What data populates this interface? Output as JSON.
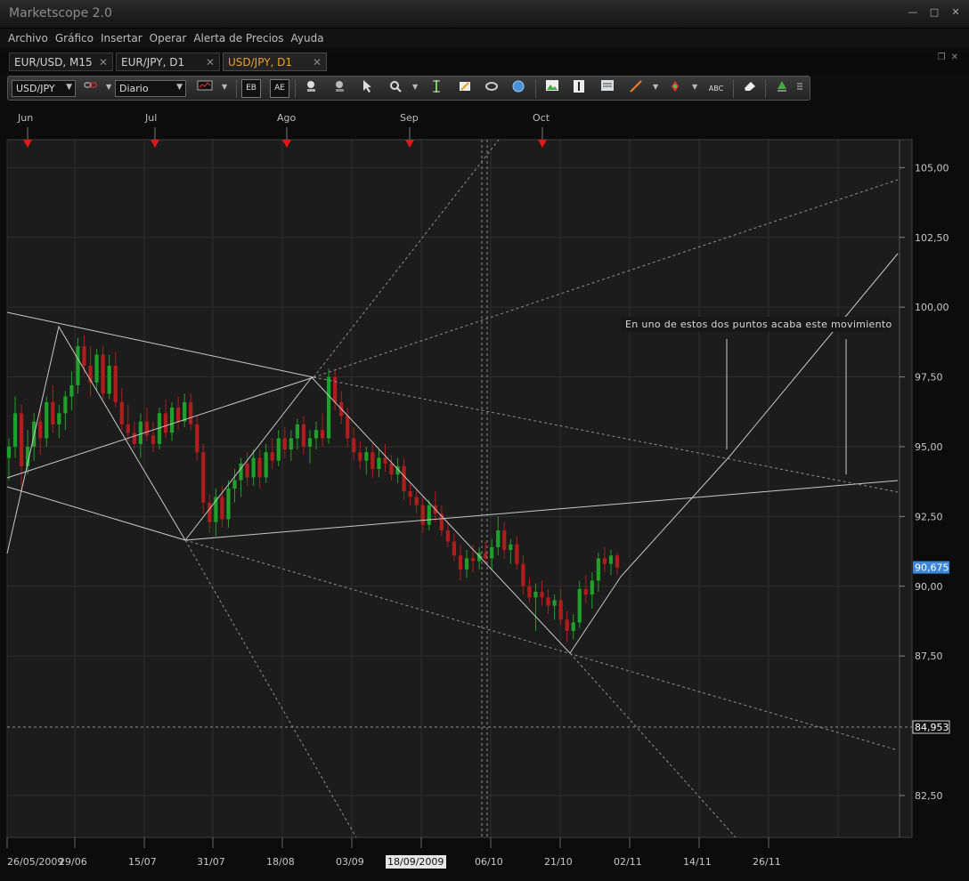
{
  "app": {
    "title": "Marketscope 2.0"
  },
  "window_controls": {
    "minimize": "—",
    "maximize": "□",
    "close": "✕"
  },
  "menu": [
    "Archivo",
    "Gráfico",
    "Insertar",
    "Operar",
    "Alerta de Precios",
    "Ayuda"
  ],
  "tabs": [
    {
      "label": "EUR/USD, M15",
      "active": false
    },
    {
      "label": "EUR/JPY, D1",
      "active": false
    },
    {
      "label": "USD/JPY, D1",
      "active": true
    }
  ],
  "tab_close": "✕",
  "toolbar": {
    "instrument": "USD/JPY",
    "timeframe": "Diario",
    "icons": [
      "link-icon",
      "candles-icon",
      "bid-icon",
      "ask-icon",
      "zoom-in-icon",
      "zoom-out-icon",
      "pointer-icon",
      "crosshair-icon",
      "cursor-value-icon",
      "properties-icon",
      "refresh-icon",
      "globe-icon",
      "picture-icon",
      "text-cursor-icon",
      "data-window-icon",
      "pen-icon",
      "marker-icon",
      "text-tool-icon",
      "eraser-icon",
      "tree-icon",
      "menu-icon"
    ],
    "icon_text_bid": "EB",
    "icon_text_ask": "AE",
    "icon_text_text": "ABC"
  },
  "chart_data": {
    "type": "candlestick",
    "instrument": "USD/JPY",
    "timeframe": "D1",
    "month_labels": [
      "Jun",
      "Jul",
      "Ago",
      "Sep",
      "Oct"
    ],
    "x_ticks": [
      "26/05/2009",
      "29/06",
      "15/07",
      "31/07",
      "18/08",
      "03/09",
      "18/09/2009",
      "06/10",
      "21/10",
      "02/11",
      "14/11",
      "26/11"
    ],
    "highlighted_x_tick": "18/09/2009",
    "y_ticks": [
      "105,00",
      "102,50",
      "100,00",
      "97,50",
      "95,00",
      "92,50",
      "90,00",
      "87,50",
      "82,50"
    ],
    "ylim": [
      81.0,
      106.0
    ],
    "current_price": "90,675",
    "marked_price": "84,953",
    "annotation": "En uno de estos dos puntos acaba este movimiento",
    "grid": true,
    "candles": [
      [
        94.6,
        95.3,
        93.8,
        95.0
      ],
      [
        95.0,
        96.8,
        94.6,
        96.2
      ],
      [
        96.2,
        96.5,
        93.4,
        94.3
      ],
      [
        94.3,
        95.6,
        94.0,
        95.0
      ],
      [
        95.0,
        96.2,
        94.5,
        95.9
      ],
      [
        95.9,
        96.4,
        94.7,
        95.3
      ],
      [
        95.3,
        96.8,
        95.0,
        96.6
      ],
      [
        96.6,
        97.2,
        95.5,
        95.8
      ],
      [
        95.8,
        96.5,
        95.3,
        96.2
      ],
      [
        96.2,
        97.0,
        95.6,
        96.8
      ],
      [
        96.8,
        97.7,
        96.3,
        97.2
      ],
      [
        97.2,
        98.9,
        96.9,
        98.6
      ],
      [
        98.6,
        99.0,
        97.6,
        97.9
      ],
      [
        97.9,
        98.6,
        96.8,
        97.3
      ],
      [
        97.3,
        98.5,
        97.0,
        98.3
      ],
      [
        98.3,
        98.6,
        96.7,
        96.9
      ],
      [
        96.9,
        98.3,
        96.7,
        97.9
      ],
      [
        97.9,
        98.4,
        96.4,
        96.6
      ],
      [
        96.6,
        97.1,
        95.6,
        95.8
      ],
      [
        95.8,
        96.5,
        95.2,
        95.5
      ],
      [
        95.5,
        95.9,
        94.9,
        95.1
      ],
      [
        95.1,
        96.2,
        94.6,
        95.9
      ],
      [
        95.9,
        96.4,
        95.2,
        95.4
      ],
      [
        95.4,
        95.9,
        94.8,
        95.1
      ],
      [
        95.1,
        96.4,
        94.9,
        96.2
      ],
      [
        96.2,
        96.7,
        95.3,
        95.5
      ],
      [
        95.5,
        96.6,
        95.2,
        96.4
      ],
      [
        96.4,
        96.8,
        95.6,
        95.9
      ],
      [
        95.9,
        96.9,
        95.7,
        96.6
      ],
      [
        96.6,
        96.9,
        95.6,
        95.8
      ],
      [
        95.8,
        96.1,
        94.5,
        94.8
      ],
      [
        94.8,
        95.1,
        92.6,
        93.0
      ],
      [
        93.0,
        93.3,
        91.9,
        92.3
      ],
      [
        92.3,
        93.5,
        91.8,
        93.2
      ],
      [
        93.2,
        93.6,
        92.1,
        92.4
      ],
      [
        92.4,
        93.8,
        92.1,
        93.5
      ],
      [
        93.5,
        94.2,
        93.0,
        93.8
      ],
      [
        93.8,
        94.6,
        93.2,
        94.4
      ],
      [
        94.4,
        94.8,
        93.6,
        93.9
      ],
      [
        93.9,
        94.9,
        93.6,
        94.6
      ],
      [
        94.6,
        94.9,
        93.5,
        93.9
      ],
      [
        93.9,
        95.1,
        93.7,
        94.8
      ],
      [
        94.8,
        95.3,
        94.2,
        94.5
      ],
      [
        94.5,
        95.6,
        94.3,
        95.3
      ],
      [
        95.3,
        95.7,
        94.6,
        94.9
      ],
      [
        94.9,
        95.6,
        94.5,
        95.3
      ],
      [
        95.3,
        96.0,
        94.9,
        95.8
      ],
      [
        95.8,
        96.1,
        94.7,
        95.0
      ],
      [
        95.0,
        95.6,
        94.4,
        95.3
      ],
      [
        95.3,
        95.9,
        94.9,
        95.6
      ],
      [
        95.6,
        96.2,
        95.0,
        95.3
      ],
      [
        95.3,
        97.8,
        95.1,
        97.5
      ],
      [
        97.5,
        97.8,
        96.3,
        96.6
      ],
      [
        96.6,
        97.0,
        95.8,
        96.1
      ],
      [
        96.1,
        96.4,
        95.0,
        95.3
      ],
      [
        95.3,
        95.7,
        94.5,
        94.8
      ],
      [
        94.8,
        95.2,
        94.2,
        94.5
      ],
      [
        94.5,
        95.0,
        94.0,
        94.8
      ],
      [
        94.8,
        95.1,
        93.9,
        94.2
      ],
      [
        94.2,
        94.9,
        93.9,
        94.6
      ],
      [
        94.6,
        95.1,
        94.1,
        94.4
      ],
      [
        94.4,
        94.7,
        93.8,
        94.0
      ],
      [
        94.0,
        94.6,
        93.7,
        94.3
      ],
      [
        94.3,
        94.6,
        93.1,
        93.4
      ],
      [
        93.4,
        93.7,
        92.9,
        93.2
      ],
      [
        93.2,
        93.5,
        92.6,
        92.9
      ],
      [
        92.9,
        93.2,
        91.9,
        92.2
      ],
      [
        92.2,
        93.1,
        92.0,
        92.9
      ],
      [
        92.9,
        93.4,
        92.3,
        92.6
      ],
      [
        92.6,
        92.9,
        91.8,
        92.0
      ],
      [
        92.0,
        92.3,
        91.4,
        91.6
      ],
      [
        91.6,
        91.9,
        90.9,
        91.1
      ],
      [
        91.1,
        91.5,
        90.2,
        90.6
      ],
      [
        90.6,
        91.3,
        90.3,
        91.0
      ],
      [
        91.0,
        91.5,
        90.5,
        90.9
      ],
      [
        90.9,
        91.4,
        90.6,
        91.2
      ],
      [
        91.2,
        91.6,
        90.8,
        91.0
      ],
      [
        91.0,
        91.7,
        90.6,
        91.4
      ],
      [
        91.4,
        92.5,
        91.1,
        92.0
      ],
      [
        92.0,
        92.3,
        91.0,
        91.3
      ],
      [
        91.3,
        91.7,
        90.8,
        91.5
      ],
      [
        91.5,
        91.8,
        90.6,
        90.8
      ],
      [
        90.8,
        91.1,
        89.7,
        90.0
      ],
      [
        90.0,
        90.3,
        89.4,
        89.6
      ],
      [
        89.6,
        90.1,
        88.4,
        89.8
      ],
      [
        89.8,
        90.2,
        89.3,
        89.6
      ],
      [
        89.6,
        89.9,
        89.0,
        89.3
      ],
      [
        89.3,
        89.7,
        88.8,
        89.5
      ],
      [
        89.5,
        89.9,
        88.6,
        88.8
      ],
      [
        88.8,
        89.1,
        88.0,
        88.4
      ],
      [
        88.4,
        89.0,
        88.1,
        88.7
      ],
      [
        88.7,
        90.2,
        88.5,
        89.9
      ],
      [
        89.9,
        90.4,
        89.4,
        89.7
      ],
      [
        89.7,
        90.5,
        89.2,
        90.2
      ],
      [
        90.2,
        91.2,
        89.8,
        91.0
      ],
      [
        91.0,
        91.4,
        90.5,
        90.8
      ],
      [
        90.8,
        91.3,
        90.4,
        91.1
      ],
      [
        91.1,
        91.2,
        90.4,
        90.675
      ]
    ]
  }
}
